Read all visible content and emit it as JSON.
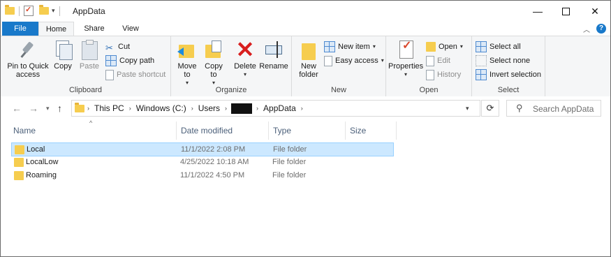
{
  "window": {
    "title": "AppData",
    "controls": {
      "minimize": "—",
      "maximize": "",
      "close": "✕"
    }
  },
  "tabs": [
    "File",
    "Home",
    "Share",
    "View"
  ],
  "ribbon": {
    "clipboard": {
      "label": "Clipboard",
      "pin": "Pin to Quick access",
      "copy": "Copy",
      "paste": "Paste",
      "cut": "Cut",
      "copy_path": "Copy path",
      "paste_shortcut": "Paste shortcut"
    },
    "organize": {
      "label": "Organize",
      "move_to": "Move to",
      "copy_to": "Copy to",
      "delete": "Delete",
      "rename": "Rename"
    },
    "new": {
      "label": "New",
      "new_folder": "New folder",
      "new_item": "New item",
      "easy_access": "Easy access"
    },
    "open": {
      "label": "Open",
      "properties": "Properties",
      "open": "Open",
      "edit": "Edit",
      "history": "History"
    },
    "select": {
      "label": "Select",
      "select_all": "Select all",
      "select_none": "Select none",
      "invert": "Invert selection"
    }
  },
  "address": {
    "crumbs": [
      "This PC",
      "Windows (C:)",
      "Users",
      "AppData"
    ],
    "search_placeholder": "Search AppData"
  },
  "columns": [
    "Name",
    "Date modified",
    "Type",
    "Size"
  ],
  "files": [
    {
      "name": "Local",
      "date": "11/1/2022 2:08 PM",
      "type": "File folder",
      "size": "",
      "selected": true
    },
    {
      "name": "LocalLow",
      "date": "4/25/2022 10:18 AM",
      "type": "File folder",
      "size": "",
      "selected": false
    },
    {
      "name": "Roaming",
      "date": "11/1/2022 4:50 PM",
      "type": "File folder",
      "size": "",
      "selected": false
    }
  ],
  "colors": {
    "accent": "#1979ca",
    "selection": "#cce8ff",
    "folder": "#f6cd4f"
  }
}
